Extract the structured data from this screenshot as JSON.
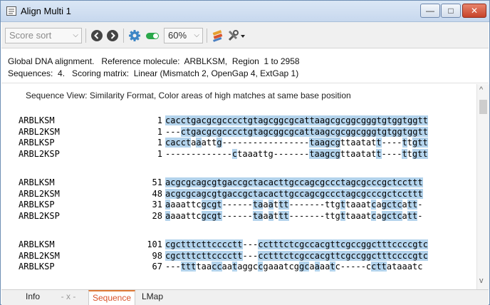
{
  "window": {
    "title": "Align Multi 1",
    "minimize_glyph": "—",
    "maximize_glyph": "□",
    "close_glyph": "✕"
  },
  "toolbar": {
    "sort_select": "Score sort",
    "zoom_select": "60%",
    "icons": [
      "back-arrow-icon",
      "forward-arrow-icon",
      "gear-icon",
      "toggle-icon",
      "highlighter-icon",
      "tools-icon"
    ]
  },
  "info": {
    "line1": "Global DNA alignment.   Reference molecule:  ARBLKSM,  Region  1 to 2958",
    "line2": "Sequences:  4.   Scoring matrix:  Linear (Mismatch 2, OpenGap 4, ExtGap 1)"
  },
  "sequence_view": {
    "label": "Sequence View:  Similarity Format, Color areas of high matches at same base position",
    "highlight_color": "#b3d3ec",
    "blocks": [
      {
        "rows": [
          {
            "name": "ARBLKSM",
            "pos": "1",
            "seq": "cacctgacgcgcccctgtagcggcgcattaagcgcggcgggtgtggtggtt"
          },
          {
            "name": "ARBL2KSM",
            "pos": "1",
            "seq": "---ctgacgcgcccctgtagcggcgcattaagcgcggcgggtgtggtggtt"
          },
          {
            "name": "ARBLKSP",
            "pos": "1",
            "seq": "cacctaaattg-----------------taagcgttaatatt----ttgtt"
          },
          {
            "name": "ARBL2KSP",
            "pos": "1",
            "seq": "-------------ctaaattg-------taagcgttaatatt----ttgtt"
          }
        ]
      },
      {
        "rows": [
          {
            "name": "ARBLKSM",
            "pos": "51",
            "seq": "acgcgcagcgtgaccgctacacttgccagcgccctagcgcccgctccttt"
          },
          {
            "name": "ARBL2KSM",
            "pos": "48",
            "seq": "acgcgcagcgtgaccgctacacttgccagcgccctagcgcccgctccttt"
          },
          {
            "name": "ARBLKSP",
            "pos": "31",
            "seq": "aaaattcgcgt------taaattt-------ttgttaaatcagctcatt-"
          },
          {
            "name": "ARBL2KSP",
            "pos": "28",
            "seq": "aaaattcgcgt------taaattt-------ttgttaaatcagctcatt-"
          }
        ]
      },
      {
        "rows": [
          {
            "name": "ARBLKSM",
            "pos": "101",
            "seq": "cgctttcttcccctt---cctttctcgccacgttcgccggctttccccgtc"
          },
          {
            "name": "ARBL2KSM",
            "pos": "98",
            "seq": "cgctttcttcccctt---cctttctcgccacgttcgccggctttccccgtc"
          },
          {
            "name": "ARBLKSP",
            "pos": "67",
            "seq": "---ttttaaccaataggccgaaatcggcaaaatc-----ccttataaatc"
          }
        ]
      }
    ]
  },
  "tabs": [
    "Info",
    "- x -",
    "Sequence",
    "LMap"
  ],
  "scrollbar": {
    "up_glyph": "^",
    "down_glyph": "v"
  }
}
